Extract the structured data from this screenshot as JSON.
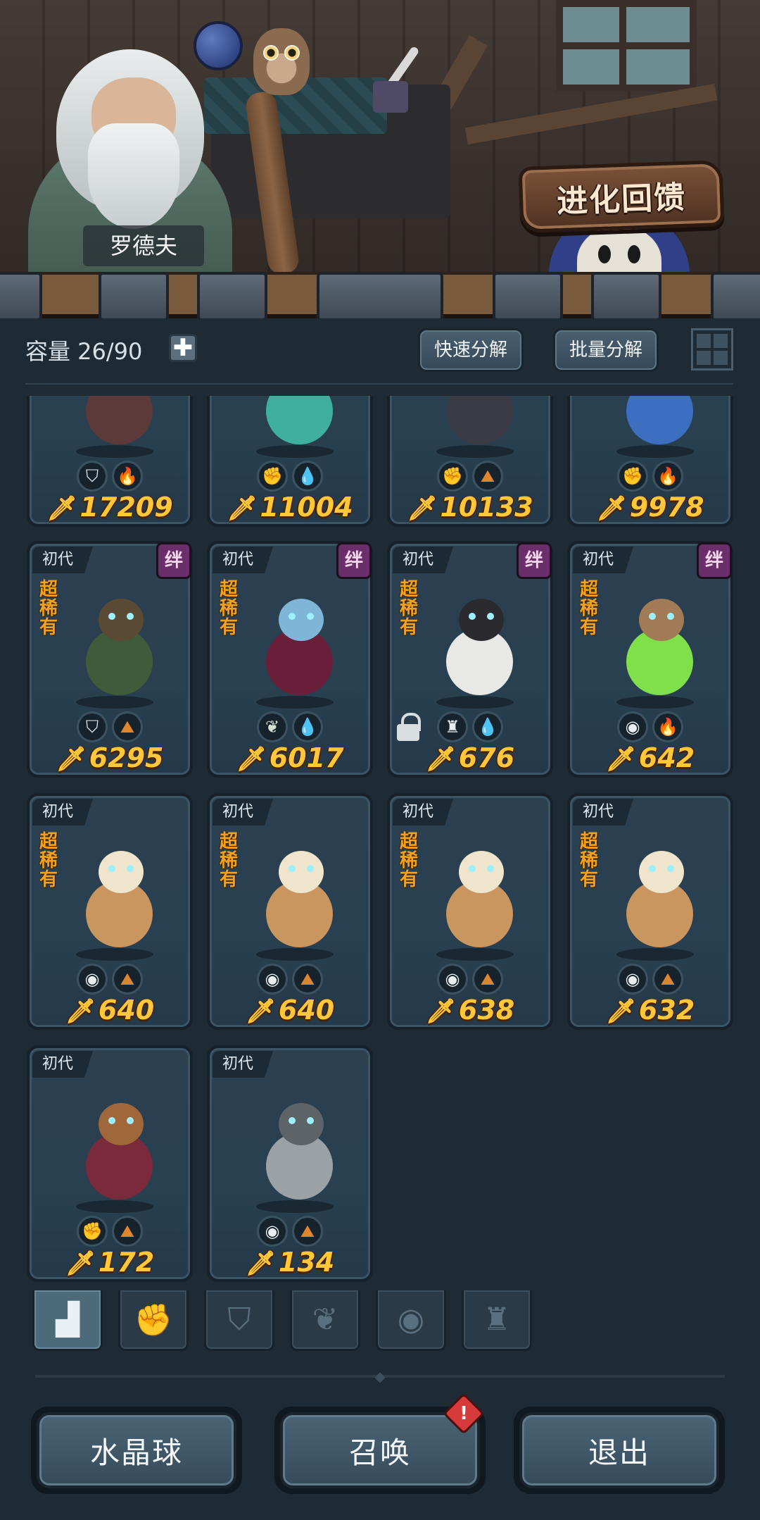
{
  "header": {
    "npc_name": "罗德夫",
    "evolve_feedback_label": "进化回馈"
  },
  "toolbar": {
    "capacity_label": "容量 26/90",
    "add_label": "✚",
    "quick_decompose_label": "快速分解",
    "batch_decompose_label": "批量分解"
  },
  "cards": [
    {
      "gen": "",
      "bond": false,
      "rarity": "",
      "locked": false,
      "icons": [
        "shield-class-icon",
        "fire-element-icon"
      ],
      "power": "17209",
      "palette": [
        "#5c3a3a",
        "#3e6b2a"
      ]
    },
    {
      "gen": "",
      "bond": false,
      "rarity": "",
      "locked": false,
      "icons": [
        "fist-class-icon",
        "water-element-icon"
      ],
      "power": "11004",
      "palette": [
        "#3fb0a0",
        "#2c7d80"
      ]
    },
    {
      "gen": "",
      "bond": false,
      "rarity": "",
      "locked": false,
      "icons": [
        "fist-class-icon",
        "earth-element-icon"
      ],
      "power": "10133",
      "palette": [
        "#3a3a44",
        "#222228"
      ]
    },
    {
      "gen": "",
      "bond": false,
      "rarity": "",
      "locked": false,
      "icons": [
        "fist-class-icon",
        "fire-element-icon"
      ],
      "power": "9978",
      "palette": [
        "#3c6fc0",
        "#c99a4a"
      ]
    },
    {
      "gen": "初代",
      "bond": true,
      "rarity": "超稀有",
      "locked": false,
      "icons": [
        "shield-class-icon",
        "earth-element-icon"
      ],
      "power": "6295",
      "palette": [
        "#3f5c3a",
        "#5b4a33"
      ]
    },
    {
      "gen": "初代",
      "bond": true,
      "rarity": "超稀有",
      "locked": false,
      "icons": [
        "plant-class-icon",
        "water-element-icon"
      ],
      "power": "6017",
      "palette": [
        "#6a1f3a",
        "#7fb6d8"
      ]
    },
    {
      "gen": "初代",
      "bond": true,
      "rarity": "超稀有",
      "locked": true,
      "icons": [
        "totem-class-icon",
        "water-element-icon"
      ],
      "power": "676",
      "palette": [
        "#e8e8e6",
        "#2b2b2f"
      ]
    },
    {
      "gen": "初代",
      "bond": true,
      "rarity": "超稀有",
      "locked": false,
      "icons": [
        "alien-class-icon",
        "fire-element-icon"
      ],
      "power": "642",
      "palette": [
        "#7fe04a",
        "#a07b55"
      ]
    },
    {
      "gen": "初代",
      "bond": false,
      "rarity": "超稀有",
      "locked": false,
      "icons": [
        "alien-class-icon",
        "earth-element-icon"
      ],
      "power": "640",
      "palette": [
        "#c8965e",
        "#efe4cc"
      ]
    },
    {
      "gen": "初代",
      "bond": false,
      "rarity": "超稀有",
      "locked": false,
      "icons": [
        "alien-class-icon",
        "earth-element-icon"
      ],
      "power": "640",
      "palette": [
        "#c8965e",
        "#efe4cc"
      ]
    },
    {
      "gen": "初代",
      "bond": false,
      "rarity": "超稀有",
      "locked": false,
      "icons": [
        "alien-class-icon",
        "earth-element-icon"
      ],
      "power": "638",
      "palette": [
        "#c8965e",
        "#efe4cc"
      ]
    },
    {
      "gen": "初代",
      "bond": false,
      "rarity": "超稀有",
      "locked": false,
      "icons": [
        "alien-class-icon",
        "earth-element-icon"
      ],
      "power": "632",
      "palette": [
        "#c8965e",
        "#efe4cc"
      ]
    },
    {
      "gen": "初代",
      "bond": false,
      "rarity": "",
      "locked": false,
      "icons": [
        "fist-class-icon",
        "earth-element-icon"
      ],
      "power": "172",
      "palette": [
        "#7a2a3a",
        "#a0683a"
      ]
    },
    {
      "gen": "初代",
      "bond": false,
      "rarity": "",
      "locked": false,
      "icons": [
        "alien-class-icon",
        "earth-element-icon"
      ],
      "power": "134",
      "palette": [
        "#9aa2a6",
        "#5d6468"
      ]
    }
  ],
  "bond_label": "绊",
  "type_tabs": [
    {
      "name": "all-types",
      "icon": "all-types-icon",
      "glyph": "▟",
      "active": true
    },
    {
      "name": "fist",
      "icon": "fist-class-icon",
      "glyph": "✊",
      "active": false
    },
    {
      "name": "shield",
      "icon": "shield-class-icon",
      "glyph": "⛉",
      "active": false
    },
    {
      "name": "plant",
      "icon": "plant-class-icon",
      "glyph": "❦",
      "active": false
    },
    {
      "name": "alien",
      "icon": "alien-class-icon",
      "glyph": "◉",
      "active": false
    },
    {
      "name": "totem",
      "icon": "totem-class-icon",
      "glyph": "♜",
      "active": false
    }
  ],
  "bottom": {
    "crystal_ball_label": "水晶球",
    "summon_label": "召唤",
    "summon_alert": "!",
    "exit_label": "退出"
  },
  "colors": {
    "power": "#ffc83a",
    "rarity": "#f3a21f",
    "bond_badge": "#6a2f6b",
    "alert": "#d73a3a"
  }
}
